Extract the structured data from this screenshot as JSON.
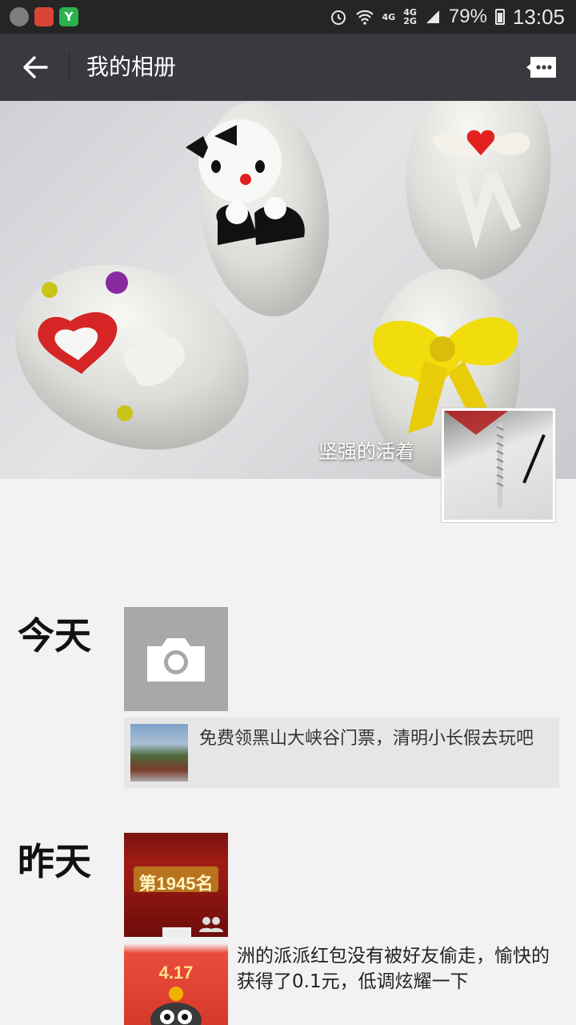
{
  "status_bar": {
    "network_top": "4G",
    "network_mid_top": "4G",
    "network_mid_bottom": "2G",
    "battery": "79%",
    "time": "13:05",
    "icons": [
      "chat-app-icon",
      "wechat-icon",
      "yixin-icon",
      "alarm-icon",
      "wifi-icon",
      "signal-icon",
      "battery-icon"
    ]
  },
  "toolbar": {
    "title": "我的相册",
    "back_icon": "arrow-left-icon",
    "message_icon": "message-bubble-icon"
  },
  "cover": {
    "user_name": "坚强的活着"
  },
  "timeline": [
    {
      "day": "今天",
      "camera_icon": "camera-icon",
      "share_text": "免费领黑山大峡谷门票，清明小长假去玩吧"
    },
    {
      "day": "昨天",
      "photo_badge": "第1945名",
      "photo2_amount": "4.17",
      "post_text": "洲的派派红包没有被好友偷走，愉快的获得了0.1元，低调炫耀一下"
    }
  ],
  "colors": {
    "toolbar_bg": "#393a3f",
    "status_bg": "#252525",
    "page_bg": "#f2f2f2"
  }
}
